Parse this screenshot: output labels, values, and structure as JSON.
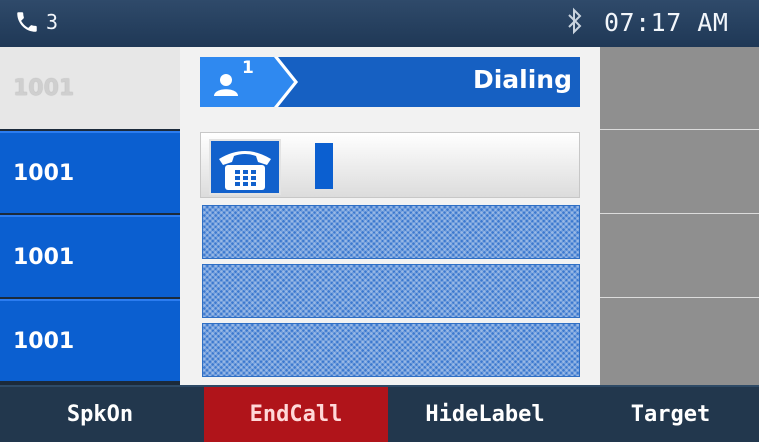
{
  "status_bar": {
    "line_count": "3",
    "phone_icon": "phone-handset-icon",
    "bluetooth_icon": "bluetooth-icon",
    "time": "07:17 AM"
  },
  "line_keys": [
    {
      "label": "1001",
      "state": "idle"
    },
    {
      "label": "1001",
      "state": "active"
    },
    {
      "label": "1001",
      "state": "active"
    },
    {
      "label": "1001",
      "state": "active"
    }
  ],
  "call": {
    "account_index": "1",
    "status": "Dialing",
    "number": ""
  },
  "softkeys": [
    {
      "label": "SpkOn"
    },
    {
      "label": "EndCall"
    },
    {
      "label": "HideLabel"
    },
    {
      "label": "Target"
    }
  ],
  "colors": {
    "accent": "#0b5fd0",
    "endcall": "#b0141a",
    "softkey_bar": "#22374d"
  }
}
